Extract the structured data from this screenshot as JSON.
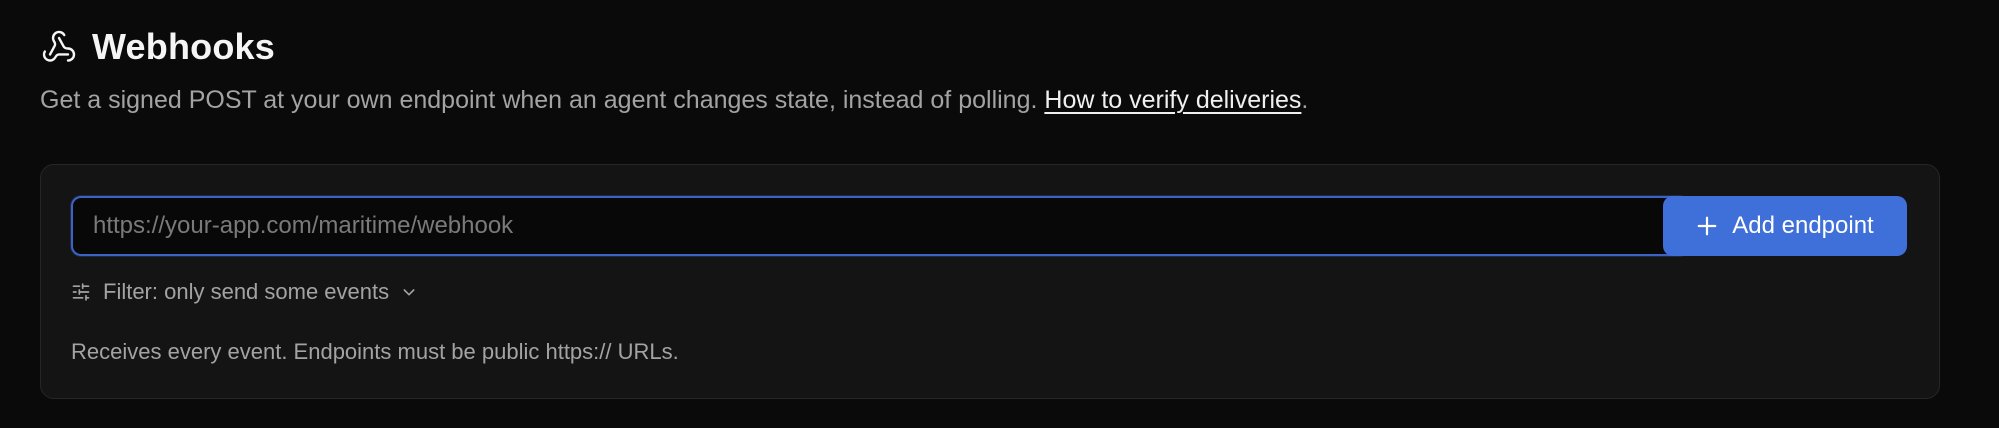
{
  "header": {
    "title": "Webhooks",
    "icon": "webhook-icon"
  },
  "description": {
    "text": "Get a signed POST at your own endpoint when an agent changes state, instead of polling.",
    "link_label": "How to verify deliveries",
    "suffix": "."
  },
  "form": {
    "url_input": {
      "value": "",
      "placeholder": "https://your-app.com/maritime/webhook"
    },
    "add_button": {
      "label": "Add endpoint",
      "icon": "plus-icon"
    },
    "filter": {
      "label": "Filter: only send some events",
      "icon": "sliders-icon",
      "chevron": "chevron-down-icon"
    },
    "hint": "Receives every event. Endpoints must be public https:// URLs."
  },
  "colors": {
    "background": "#0a0a0a",
    "card": "#141414",
    "accent": "#3f6fd8",
    "input_focus_border": "#3b63c4"
  }
}
